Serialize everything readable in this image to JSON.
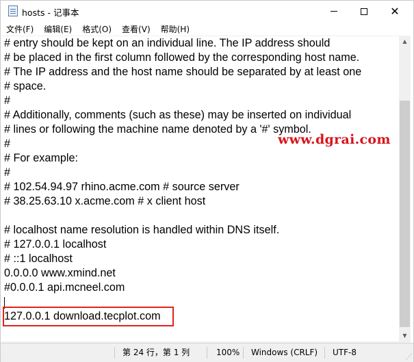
{
  "window": {
    "title": "hosts - 记事本",
    "minimize_icon": "minimize-icon",
    "maximize_icon": "maximize-icon",
    "close_icon": "close-icon",
    "close_glyph": "✕"
  },
  "menu": [
    {
      "label": "文件(F)"
    },
    {
      "label": "编辑(E)"
    },
    {
      "label": "格式(O)"
    },
    {
      "label": "查看(V)"
    },
    {
      "label": "帮助(H)"
    }
  ],
  "editor": {
    "lines": [
      "# entry should be kept on an individual line. The IP address should",
      "# be placed in the first column followed by the corresponding host name.",
      "# The IP address and the host name should be separated by at least one",
      "# space.",
      "#",
      "# Additionally, comments (such as these) may be inserted on individual",
      "# lines or following the machine name denoted by a '#' symbol.",
      "#",
      "# For example:",
      "#",
      "# 102.54.94.97 rhino.acme.com # source server",
      "# 38.25.63.10 x.acme.com # x client host",
      "",
      "# localhost name resolution is handled within DNS itself.",
      "# 127.0.0.1 localhost",
      "# ::1 localhost",
      "0.0.0.0 www.xmind.net",
      "#0.0.0.1 api.mcneel.com",
      "",
      "127.0.0.1 download.tecplot.com"
    ],
    "highlight_color": "#e3201b"
  },
  "watermark": {
    "text": "www.dgrai.com",
    "color": "#d9141b"
  },
  "status": {
    "position": "第 24 行，第 1 列",
    "zoom": "100%",
    "line_ending": "Windows (CRLF)",
    "encoding": "UTF-8"
  },
  "scrollbar": {
    "up_icon": "scroll-up-arrow-icon",
    "down_icon": "scroll-down-arrow-icon"
  }
}
